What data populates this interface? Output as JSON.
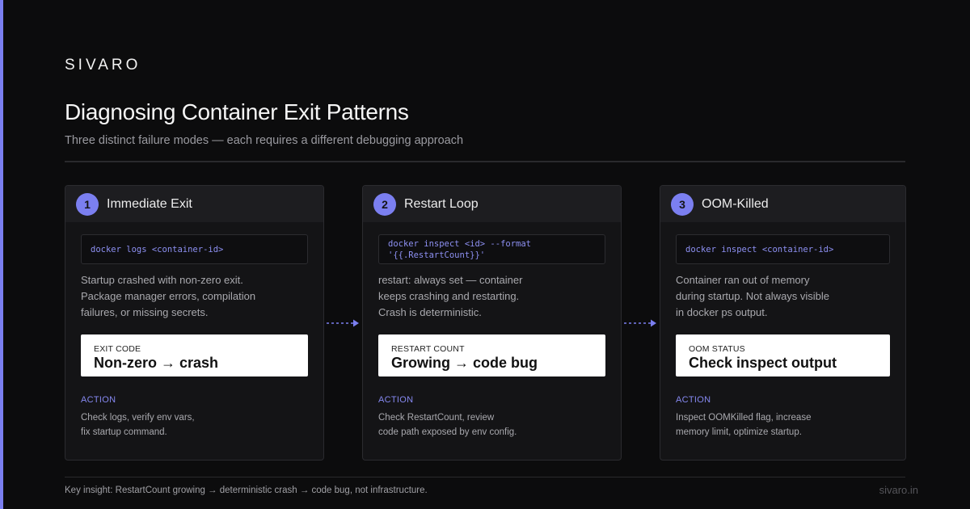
{
  "brand": "SIVARO",
  "title": "Diagnosing Container Exit Patterns",
  "subtitle": "Three distinct failure modes — each requires a different debugging approach",
  "colors": {
    "accent": "#7b7ff0",
    "background": "#0c0c0d",
    "card": "#141416"
  },
  "cards": [
    {
      "number": "1",
      "title": "Immediate Exit",
      "code_lines": [
        "docker logs <container-id>"
      ],
      "description_lines": [
        "Startup crashed with non-zero exit.",
        "Package manager errors, compilation",
        "failures, or missing secrets."
      ],
      "metric_label": "EXIT CODE",
      "metric_value": "Non-zero → crash",
      "action_label": "ACTION",
      "action_lines": [
        "Check logs, verify env vars,",
        "fix startup command."
      ]
    },
    {
      "number": "2",
      "title": "Restart Loop",
      "code_lines": [
        "docker inspect <id> --format",
        "'{{.RestartCount}}'"
      ],
      "description_lines": [
        "restart: always set — container",
        "keeps crashing and restarting.",
        "Crash is deterministic."
      ],
      "metric_label": "RESTART COUNT",
      "metric_value": "Growing → code bug",
      "action_label": "ACTION",
      "action_lines": [
        "Check RestartCount, review",
        "code path exposed by env config."
      ]
    },
    {
      "number": "3",
      "title": "OOM-Killed",
      "code_lines": [
        "docker inspect <container-id>"
      ],
      "description_lines": [
        "Container ran out of memory",
        "during startup. Not always visible",
        "in docker ps output."
      ],
      "metric_label": "OOM STATUS",
      "metric_value": "Check inspect output",
      "action_label": "ACTION",
      "action_lines": [
        "Inspect OOMKilled flag, increase",
        "memory limit, optimize startup."
      ]
    }
  ],
  "footer": {
    "insight": "Key insight: RestartCount growing → deterministic crash → code bug, not infrastructure.",
    "url": "sivaro.in"
  }
}
